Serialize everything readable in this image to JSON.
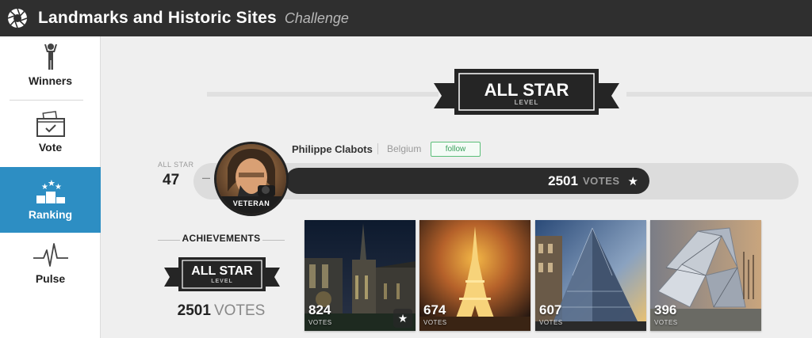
{
  "header": {
    "title": "Landmarks and Historic Sites",
    "subtitle": "Challenge"
  },
  "sidebar": {
    "items": [
      {
        "label": "Winners",
        "icon": "trophy-person-icon",
        "active": false
      },
      {
        "label": "Vote",
        "icon": "ballot-box-icon",
        "active": false
      },
      {
        "label": "Ranking",
        "icon": "podium-stars-icon",
        "active": true
      },
      {
        "label": "Pulse",
        "icon": "pulse-line-icon",
        "active": false
      }
    ]
  },
  "level_badge": {
    "title": "ALL STAR",
    "sub": "LEVEL"
  },
  "rank": {
    "category": "ALL STAR",
    "position": "47",
    "dash": "–"
  },
  "user": {
    "name": "Philippe Clabots",
    "country": "Belgium",
    "follow_label": "follow",
    "avatar_rank": "VETERAN"
  },
  "votes_bar": {
    "value": "2501",
    "label": "VOTES",
    "icon": "star-icon"
  },
  "achievements": {
    "title": "ACHIEVEMENTS",
    "badge_title": "ALL STAR",
    "badge_sub": "LEVEL",
    "votes_value": "2501",
    "votes_label": "VOTES"
  },
  "photos": [
    {
      "votes": "824",
      "label": "VOTES",
      "starred": true,
      "subject": "gothic-cathedral-night"
    },
    {
      "votes": "674",
      "label": "VOTES",
      "starred": false,
      "subject": "eiffel-tower-night"
    },
    {
      "votes": "607",
      "label": "VOTES",
      "starred": false,
      "subject": "glass-pyramid-sunset"
    },
    {
      "votes": "396",
      "label": "VOTES",
      "starred": false,
      "subject": "glass-sail-building"
    }
  ],
  "colors": {
    "topbar": "#2f2f2f",
    "accent": "#2d8ec3",
    "follow_green": "#3aa05c",
    "badge_dark": "#252525"
  }
}
